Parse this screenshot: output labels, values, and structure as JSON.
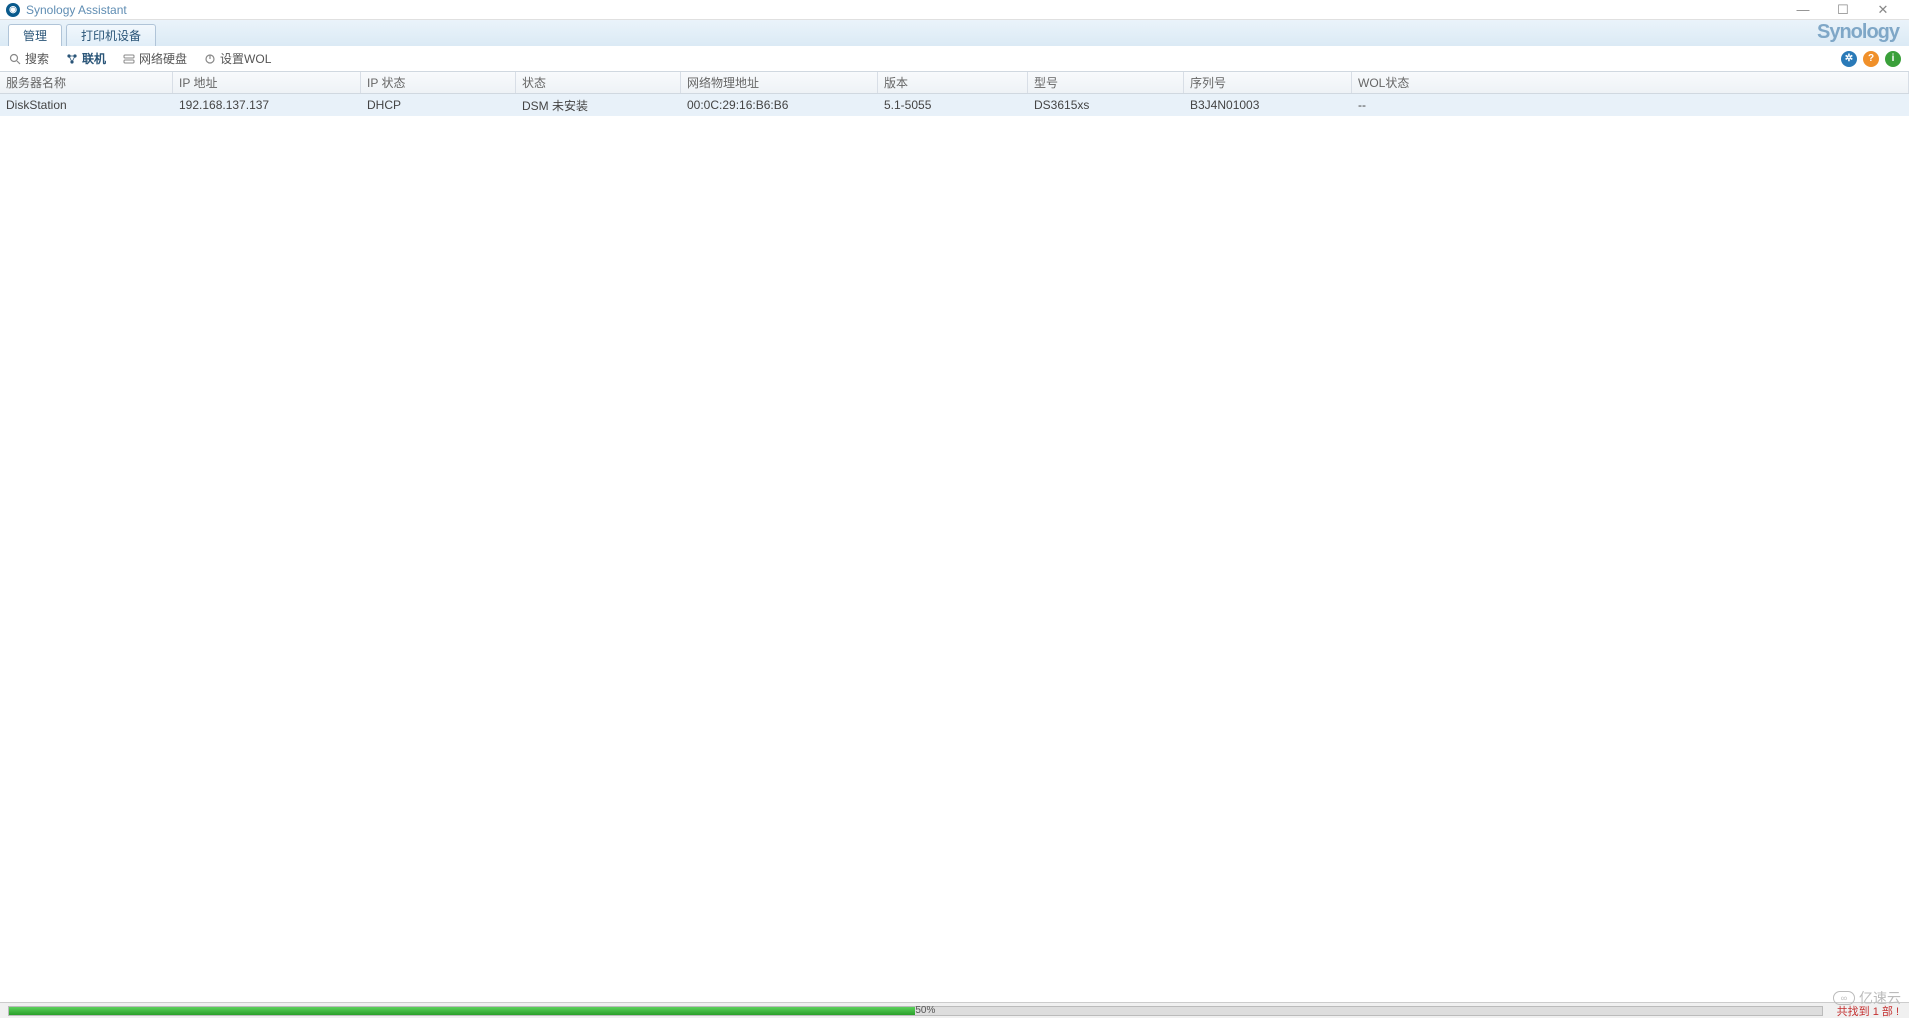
{
  "window": {
    "title": "Synology Assistant",
    "brand": "Synology"
  },
  "tabs": [
    {
      "label": "管理",
      "active": true
    },
    {
      "label": "打印机设备",
      "active": false
    }
  ],
  "toolbar": {
    "search": "搜索",
    "connect": "联机",
    "network_drive": "网络硬盘",
    "set_wol": "设置WOL"
  },
  "columns": {
    "server_name": "服务器名称",
    "ip_address": "IP 地址",
    "ip_status": "IP 状态",
    "status": "状态",
    "mac": "网络物理地址",
    "version": "版本",
    "model": "型号",
    "serial": "序列号",
    "wol_status": "WOL状态"
  },
  "rows": [
    {
      "server_name": "DiskStation",
      "ip_address": "192.168.137.137",
      "ip_status": "DHCP",
      "status": "DSM 未安装",
      "mac": "00:0C:29:16:B6:B6",
      "version": "5.1-5055",
      "model": "DS3615xs",
      "serial": "B3J4N01003",
      "wol_status": "--"
    }
  ],
  "progress": {
    "percent": "50%",
    "width_pct": 50
  },
  "footer": {
    "found_text": "共找到 1 部 !"
  },
  "watermark": {
    "text": "亿速云"
  }
}
